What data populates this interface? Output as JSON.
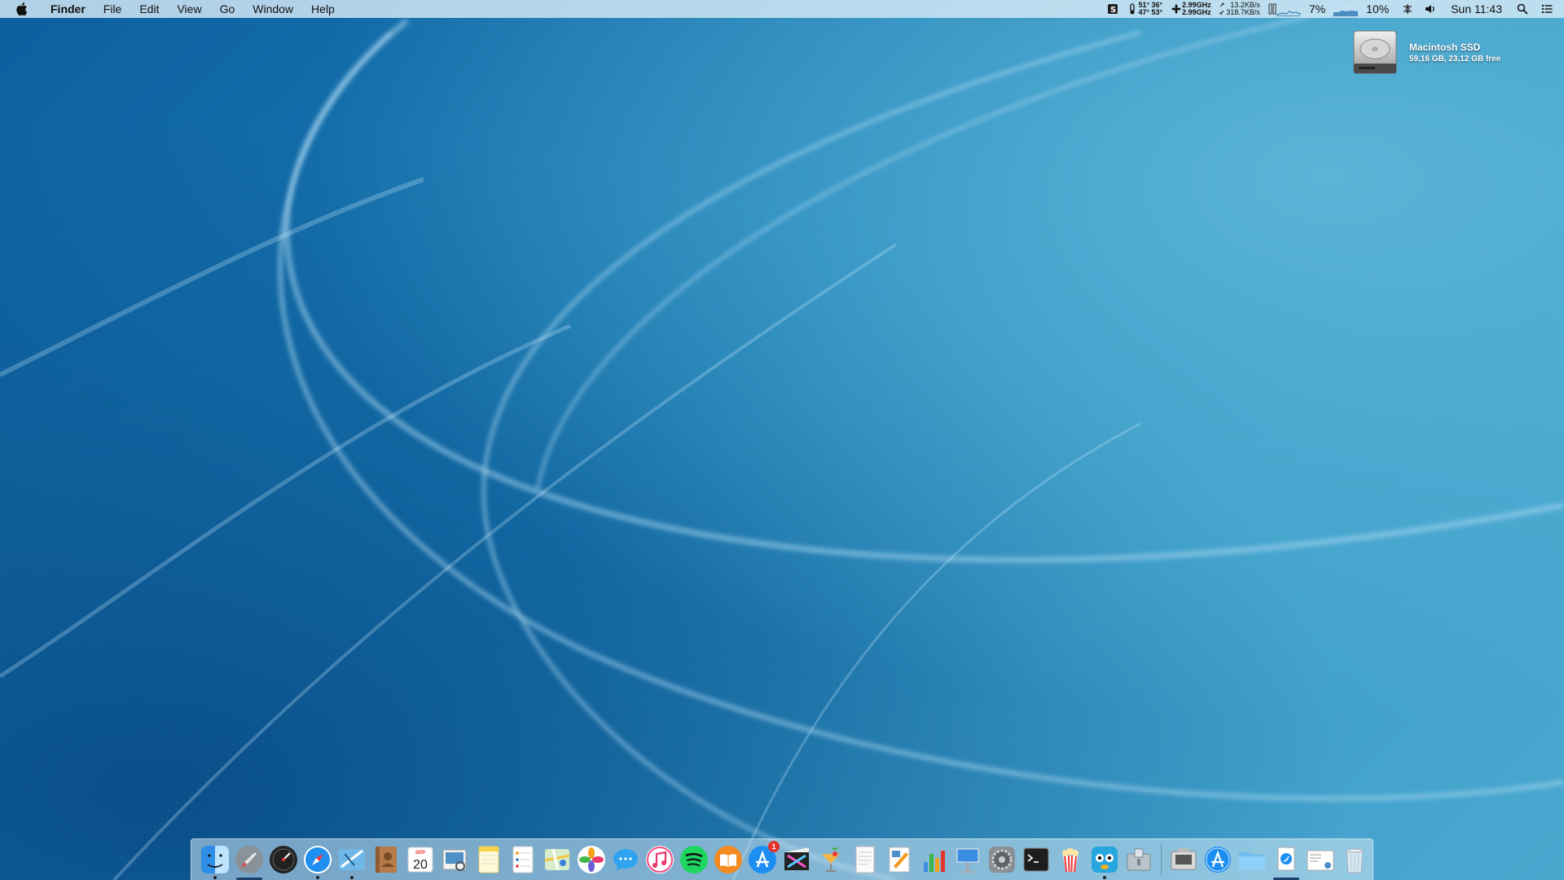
{
  "menubar": {
    "app_name": "Finder",
    "menus": [
      "File",
      "Edit",
      "View",
      "Go",
      "Window",
      "Help"
    ],
    "temps_top": "51° 36°",
    "temps_bottom": "47° 53°",
    "cpu_top": "2.99GHz",
    "cpu_bottom": "2.99GHz",
    "net_up": "13.2KB/s",
    "net_down": "318.7KB/s",
    "cpu_percent": "7%",
    "mem_percent": "10%",
    "clock": "Sun 11:43"
  },
  "desktop": {
    "drive_name": "Macintosh SSD",
    "drive_info": "59,16 GB, 23,12 GB free"
  },
  "dock": {
    "calendar_month": "SEP",
    "calendar_day": "20",
    "app_store_badge": "1",
    "items": [
      "finder-icon",
      "launchpad-icon",
      "dashboard-icon",
      "safari-icon",
      "mail-icon",
      "contacts-icon",
      "calendar-icon",
      "preview-icon",
      "notes-icon",
      "reminders-icon",
      "maps-icon",
      "photos-icon",
      "messages-icon",
      "itunes-icon",
      "spotify-icon",
      "ibooks-icon",
      "app-store-icon",
      "final-cut-icon",
      "cocktail-icon",
      "textedit-icon",
      "pages-icon",
      "numbers-icon",
      "keynote-icon",
      "system-preferences-icon",
      "terminal-icon",
      "popcorn-time-icon",
      "tweetbot-icon",
      "archive-utility-icon",
      "image-capture-icon",
      "app-store-folder-icon",
      "documents-folder-icon",
      "downloads-icon",
      "preview-stack-icon",
      "trash-icon"
    ]
  },
  "colors": {
    "menubar": "#d6eaf6",
    "wallpaper_deep": "#0d5f9e",
    "wallpaper_light": "#4aa8cf",
    "badge": "#e4322b"
  }
}
